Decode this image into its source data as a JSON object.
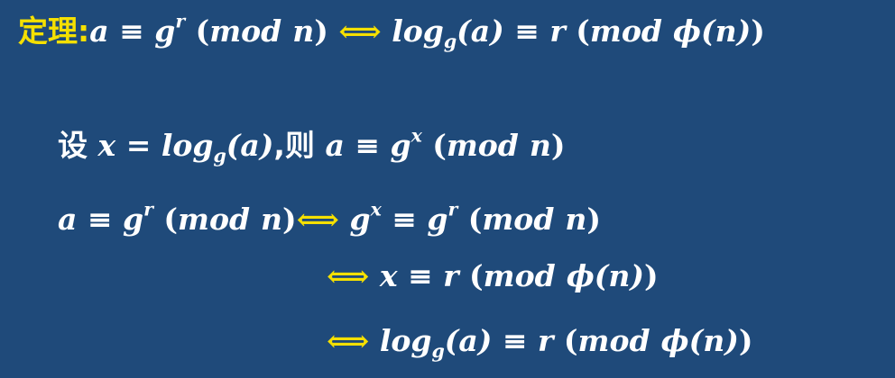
{
  "theorem": {
    "label": "定理:",
    "a": "a",
    "eq": "≡",
    "g": "g",
    "r": "r",
    "mod": "mod",
    "n": "n",
    "iff": "⟺",
    "log": "log",
    "sub_g": "g",
    "arg": "(a)",
    "phi": "ϕ",
    "paren_n": "(n)"
  },
  "let_line": {
    "she": "设",
    "x": "x",
    "equals": "=",
    "log": "log",
    "sub_g": "g",
    "arg": "(a)",
    "comma_ze": ",则",
    "a": "a",
    "eq": "≡",
    "g": "g",
    "sup_x": "x",
    "mod": "mod",
    "n": "n"
  },
  "step1": {
    "a": "a",
    "eq": "≡",
    "g": "g",
    "sup_r": "r",
    "mod": "mod",
    "n": "n",
    "iff": "⟺",
    "g2": "g",
    "sup_x": "x",
    "eq2": "≡",
    "g3": "g",
    "sup_r2": "r",
    "mod2": "mod",
    "n2": "n"
  },
  "step2": {
    "iff": "⟺",
    "x": "x",
    "eq": "≡",
    "r": "r",
    "mod": "mod",
    "phi": "ϕ",
    "paren_n": "(n)"
  },
  "step3": {
    "iff": "⟺",
    "log": "log",
    "sub_g": "g",
    "arg": "(a)",
    "eq": "≡",
    "r": "r",
    "mod": "mod",
    "phi": "ϕ",
    "paren_n": "(n)"
  }
}
